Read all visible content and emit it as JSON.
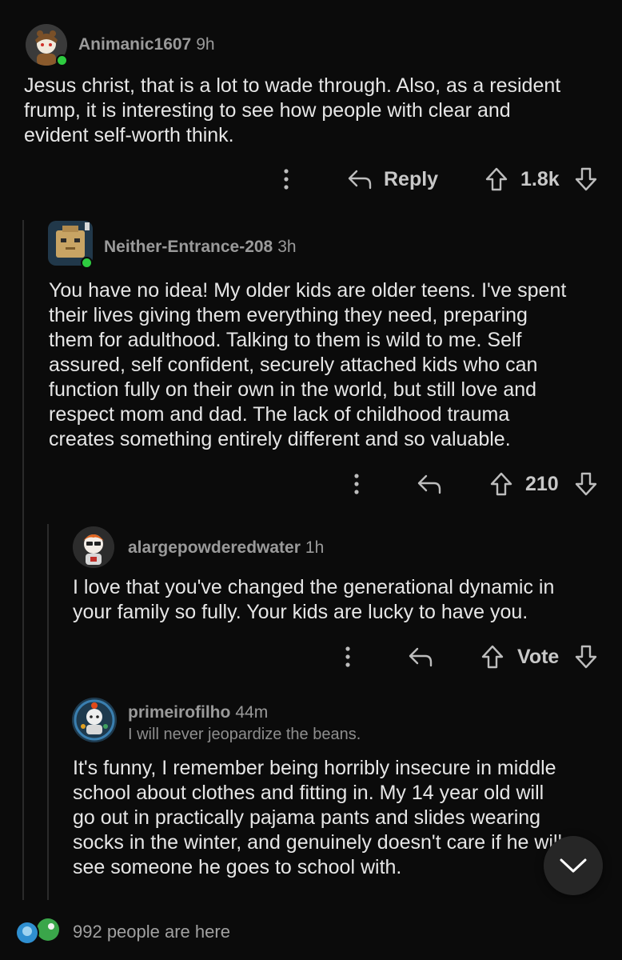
{
  "comments": [
    {
      "username": "Animanic1607",
      "time": "9h",
      "lines": [
        "Jesus christ, that is a lot to wade through. Also, as a resident",
        "frump, it is interesting to see how people with clear and",
        "evident self-worth think."
      ],
      "reply_label": "Reply",
      "vote_count": "1.8k"
    },
    {
      "username": "Neither-Entrance-208",
      "time": "3h",
      "lines": [
        "You have no idea! My older kids are older teens. I've spent",
        "their lives giving them everything they need, preparing",
        "them for adulthood. Talking to them is wild to me. Self",
        "assured, self confident, securely attached kids who can",
        "function fully on their own in the world, but still love and",
        "respect mom and dad. The lack of childhood trauma",
        "creates something entirely different and so valuable."
      ],
      "vote_count": "210"
    },
    {
      "username": "alargepowderedwater",
      "time": "1h",
      "lines": [
        "I love that you've changed the generational dynamic in",
        "your family so fully. Your kids are lucky to have you."
      ],
      "vote_count": "Vote"
    },
    {
      "username": "primeirofilho",
      "time": "44m",
      "flair": "I will never jeopardize the beans.",
      "lines": [
        "It's funny, I remember being horribly insecure in middle",
        "school about clothes and fitting in. My 14 year old will",
        "go out in practically pajama pants and slides wearing",
        "socks in the winter, and genuinely doesn't care if he will",
        "see someone he goes to school with."
      ]
    }
  ],
  "presence": {
    "text": "992 people are here"
  },
  "colors": {
    "background": "#0b0b0b",
    "online": "#2ecc40",
    "fab": "#262626"
  },
  "icons": [
    "more-icon",
    "reply-icon",
    "upvote-icon",
    "downvote-icon",
    "chevron-down-icon"
  ]
}
